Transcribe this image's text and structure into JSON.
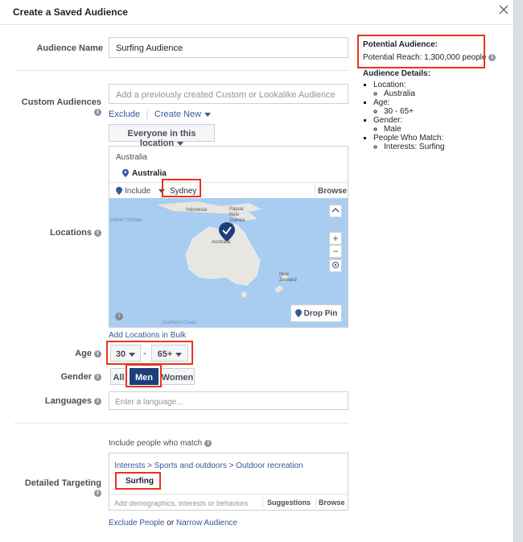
{
  "dialog": {
    "title": "Create a Saved Audience"
  },
  "audience_name": {
    "label": "Audience Name",
    "value": "Surfing Audience"
  },
  "custom_audiences": {
    "label": "Custom Audiences",
    "placeholder": "Add a previously created Custom or Lookalike Audience",
    "exclude": "Exclude",
    "create_new": "Create New"
  },
  "locations": {
    "label": "Locations",
    "scope": "Everyone in this location",
    "country_header": "Australia",
    "selected": "Australia",
    "include": "Include",
    "search_value": "Sydney",
    "browse": "Browse",
    "map_labels": {
      "ocean_left": "ndian Ocean",
      "indonesia": "Indonesia",
      "papua": "Papua New Guinea",
      "australia": "Australia",
      "nz": "New Zealand",
      "southern": "Southern Ocean"
    },
    "drop_pin": "Drop Pin",
    "bulk": "Add Locations in Bulk"
  },
  "age": {
    "label": "Age",
    "min": "30",
    "max": "65+",
    "dash": "-"
  },
  "gender": {
    "label": "Gender",
    "options": [
      "All",
      "Men",
      "Women"
    ]
  },
  "languages": {
    "label": "Languages",
    "placeholder": "Enter a language..."
  },
  "detailed": {
    "label": "Detailed Targeting",
    "heading": "Include people who match",
    "breadcrumb": [
      "Interests",
      ">",
      "Sports and outdoors",
      ">",
      "Outdoor recreation"
    ],
    "interest": "Surfing",
    "placeholder": "Add demographics, interests or behaviors",
    "suggestions": "Suggestions",
    "browse": "Browse",
    "exclude": "Exclude People",
    "or": "or",
    "narrow": "Narrow Audience"
  },
  "potential": {
    "title": "Potential Audience:",
    "reach": "Potential Reach: 1,300,000 people",
    "details_title": "Audience Details:",
    "location_label": "Location:",
    "location_value": "Australia",
    "age_label": "Age:",
    "age_value": "30 - 65+",
    "gender_label": "Gender:",
    "gender_value": "Male",
    "match_label": "People Who Match:",
    "match_value": "Interests: Surfing"
  },
  "colors": {
    "accent": "#365899",
    "selected_gender": "#1c3f7c",
    "highlight": "#e8341c"
  }
}
